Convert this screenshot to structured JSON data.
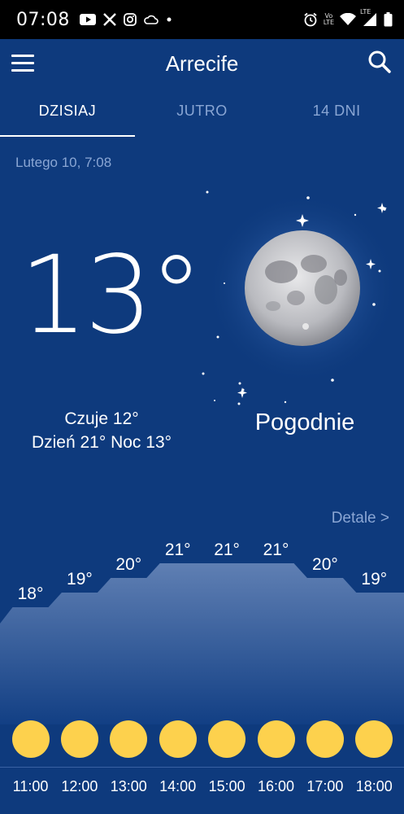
{
  "status_bar": {
    "time": "07:08",
    "left_icons": [
      "youtube-icon",
      "x-icon",
      "instagram-icon",
      "cloud-icon",
      "dot-icon"
    ],
    "right_icons": [
      "alarm-icon",
      "volte-icon",
      "wifi-icon",
      "signal-icon",
      "battery-icon"
    ],
    "volte_label_top": "Vo",
    "volte_label_bottom": "LTE",
    "lte_label": "LTE"
  },
  "app_bar": {
    "title": "Arrecife"
  },
  "tabs": [
    {
      "label": "DZISIAJ",
      "active": true
    },
    {
      "label": "JUTRO",
      "active": false
    },
    {
      "label": "14 DNI",
      "active": false
    }
  ],
  "current": {
    "date": "Lutego 10, 7:08",
    "temperature": "13°",
    "feels_like": "Czuje 12°",
    "day_night": "Dzień 21° Noc 13°",
    "condition": "Pogodnie",
    "icon": "moon-icon"
  },
  "details_link": "Detale >",
  "hourly": {
    "temps": [
      {
        "label": "18°",
        "value": 18
      },
      {
        "label": "19°",
        "value": 19
      },
      {
        "label": "20°",
        "value": 20
      },
      {
        "label": "21°",
        "value": 21
      },
      {
        "label": "21°",
        "value": 21
      },
      {
        "label": "21°",
        "value": 21
      },
      {
        "label": "20°",
        "value": 20
      },
      {
        "label": "19°",
        "value": 19
      }
    ],
    "times": [
      "11:00",
      "12:00",
      "13:00",
      "14:00",
      "15:00",
      "16:00",
      "17:00",
      "18:00"
    ],
    "icon": "sun-icon"
  },
  "colors": {
    "background": "#0e3a7d",
    "sun": "#fdd14d",
    "muted_text": "#8aa6d4"
  }
}
